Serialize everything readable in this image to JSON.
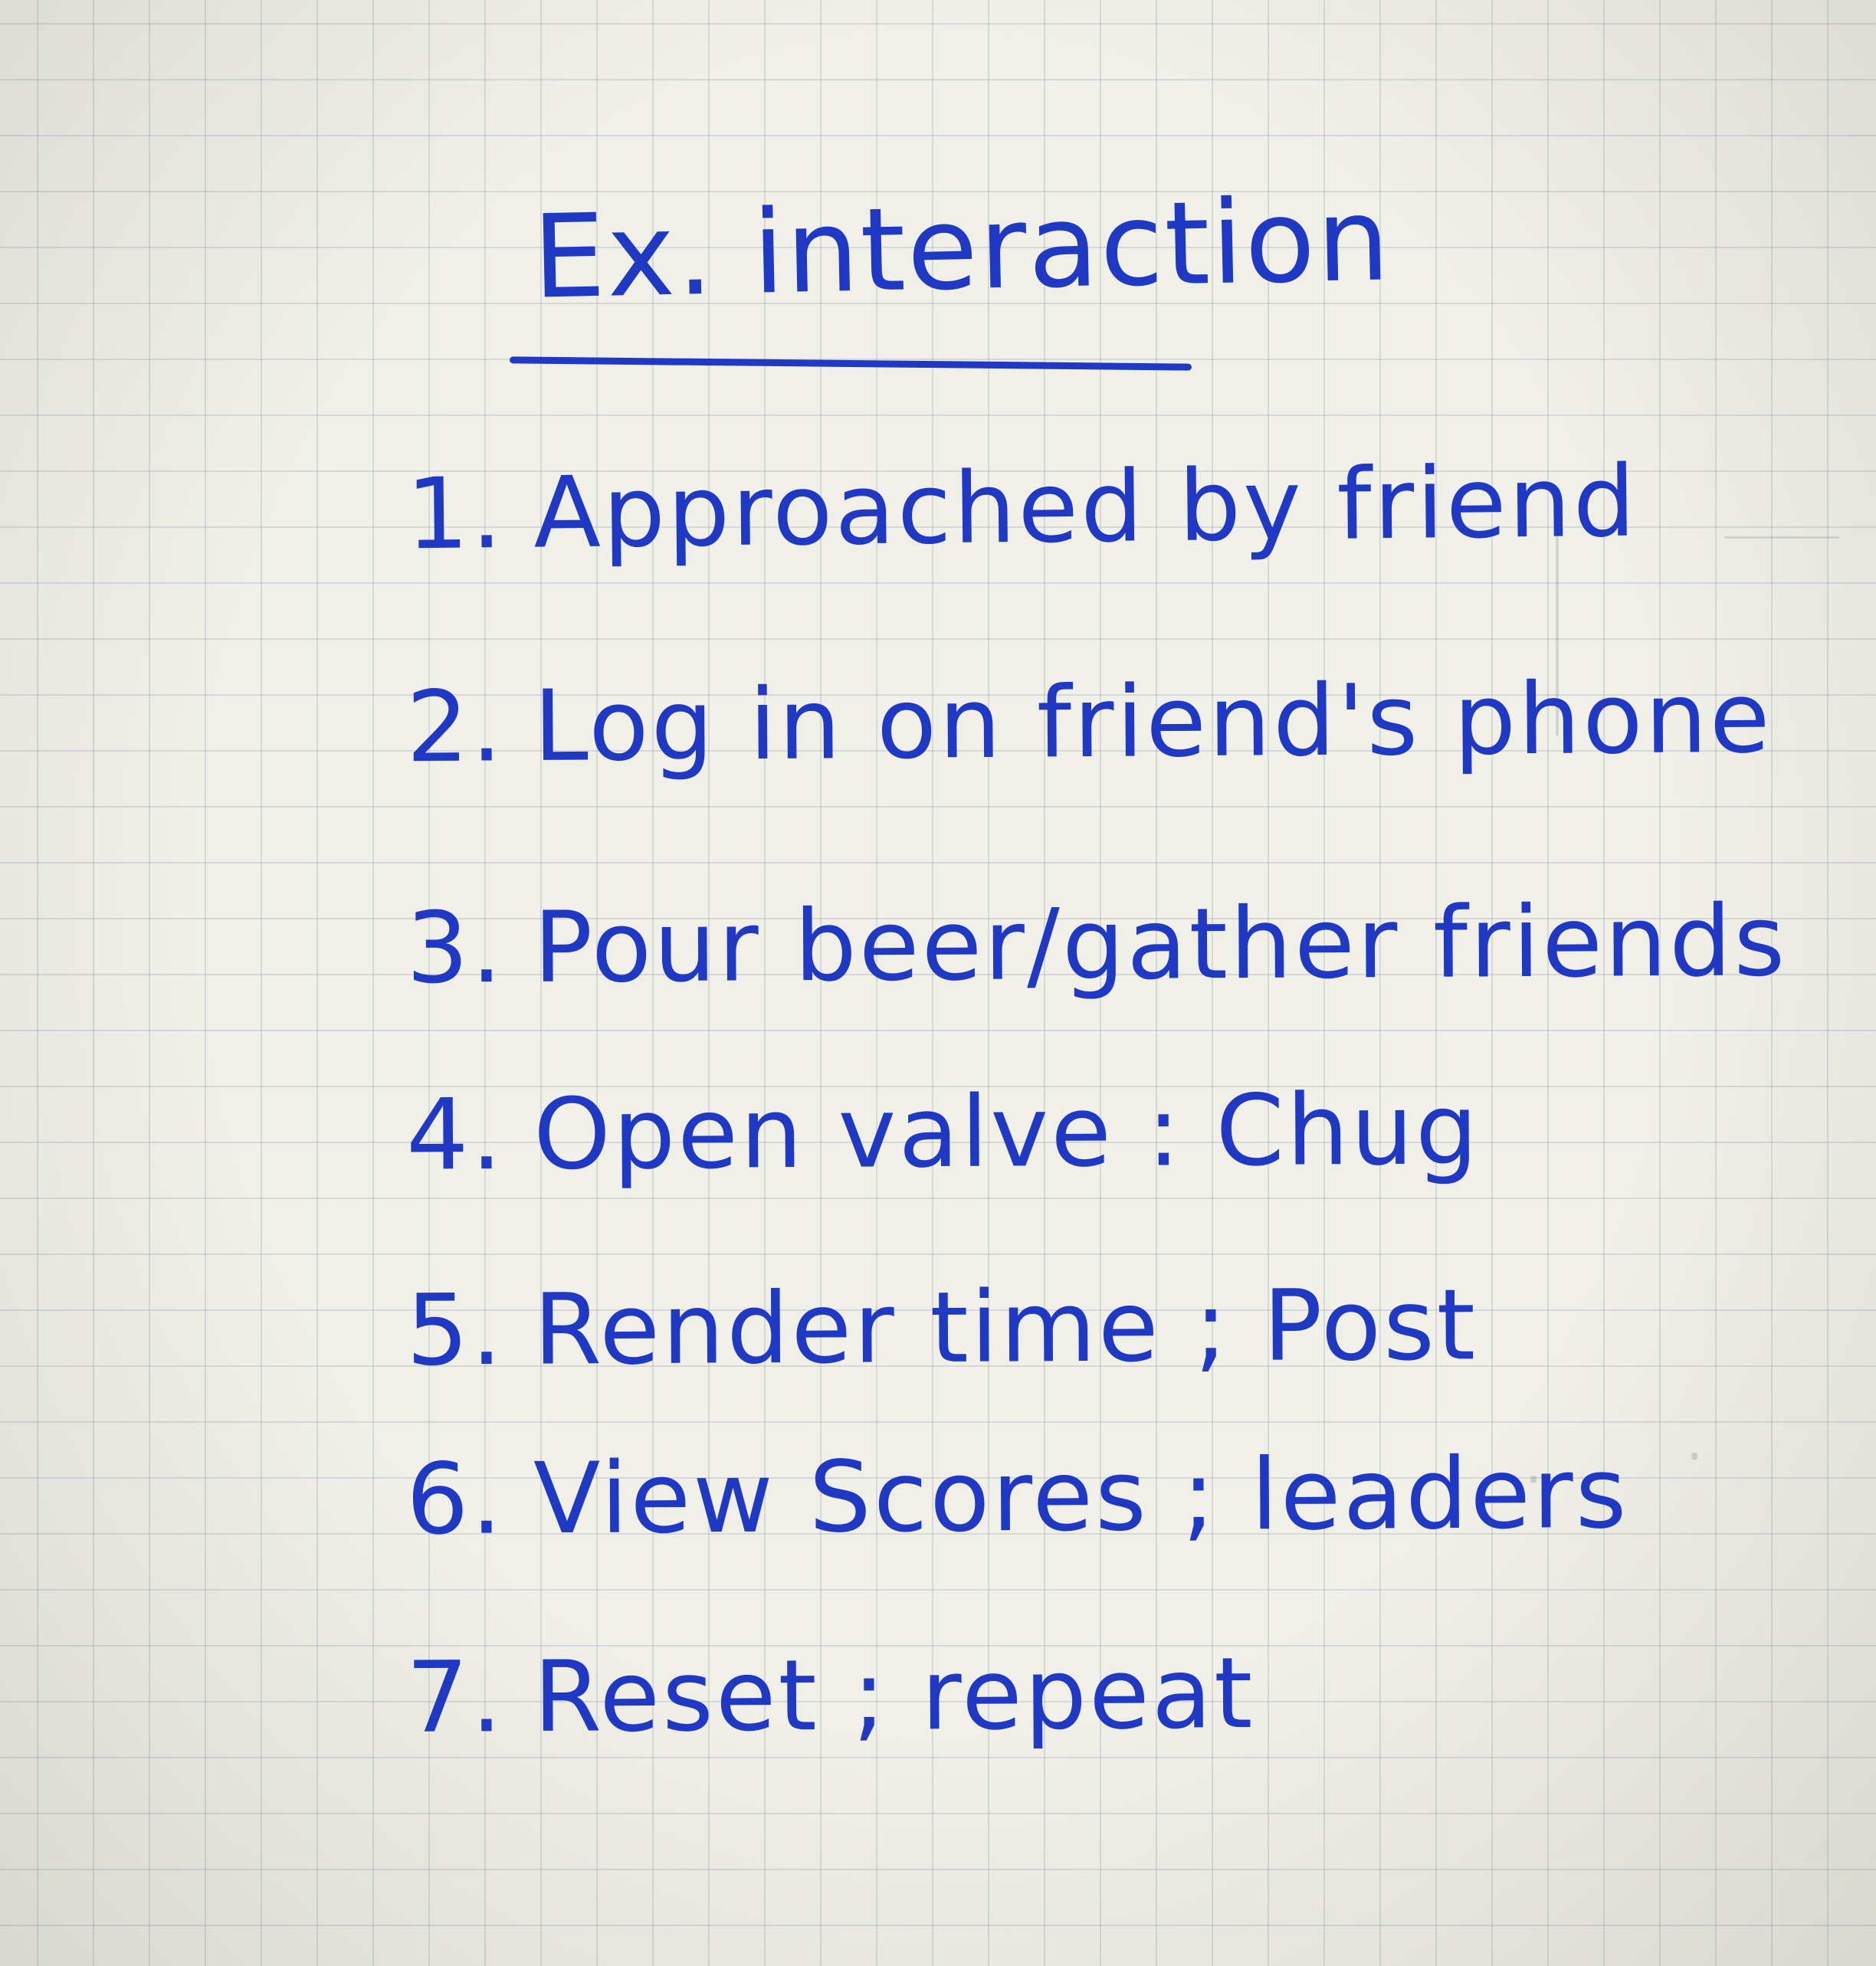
{
  "note": {
    "title": "Ex. interaction",
    "steps": [
      {
        "num": "1.",
        "text": "Approached by friend"
      },
      {
        "num": "2.",
        "text": "Log in on friend's phone"
      },
      {
        "num": "3.",
        "text": "Pour beer/gather friends"
      },
      {
        "num": "4.",
        "text": "Open valve : Chug"
      },
      {
        "num": "5.",
        "text": "Render time ; Post"
      },
      {
        "num": "6.",
        "text": "View Scores ; leaders"
      },
      {
        "num": "7.",
        "text": "Reset ; repeat"
      }
    ]
  },
  "colors": {
    "ink": "#1f39c4",
    "paper": "#f1f0e8",
    "grid": "#7882a0"
  }
}
